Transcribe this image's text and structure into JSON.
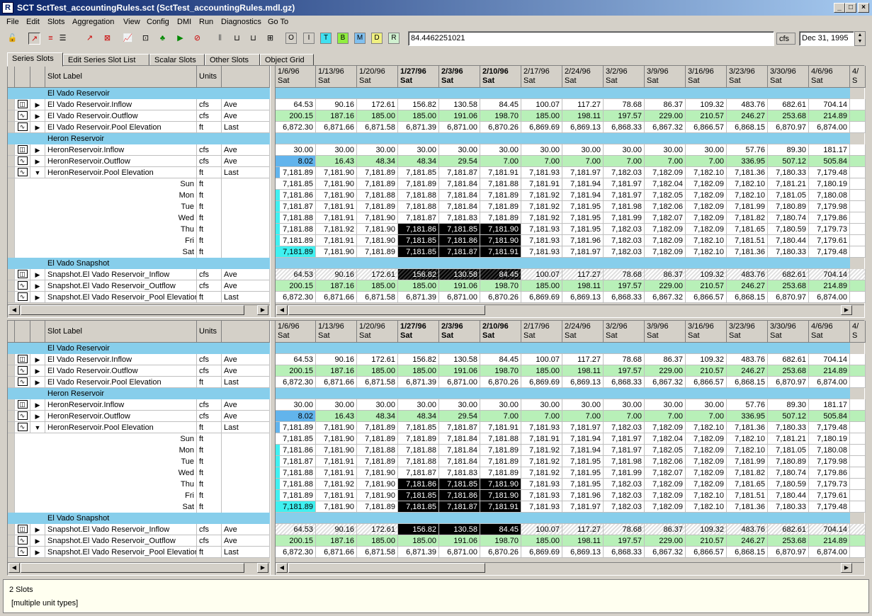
{
  "window": {
    "title": "SCT SctTest_accountingRules.sct (SctTest_accountingRules.mdl.gz)"
  },
  "menu": [
    "File",
    "Edit",
    "Slots",
    "Aggregation",
    "View",
    "Config",
    "DMI",
    "Run",
    "Diagnostics",
    "Go To"
  ],
  "toolbar": {
    "letters": [
      "O",
      "I",
      "T",
      "B",
      "M",
      "D",
      "R"
    ],
    "value": "84.4462251021",
    "units": "cfs",
    "date": "Dec 31, 1995"
  },
  "tabs": [
    "Series Slots",
    "Edit Series Slot List",
    "Scalar Slots",
    "Other Slots",
    "Object Grid"
  ],
  "headers": {
    "slot_label": "Slot Label",
    "units": "Units"
  },
  "dates": [
    {
      "d": "1/6/96",
      "w": "Sat",
      "b": false
    },
    {
      "d": "1/13/96",
      "w": "Sat",
      "b": false
    },
    {
      "d": "1/20/96",
      "w": "Sat",
      "b": false
    },
    {
      "d": "1/27/96",
      "w": "Sat",
      "b": true
    },
    {
      "d": "2/3/96",
      "w": "Sat",
      "b": true
    },
    {
      "d": "2/10/96",
      "w": "Sat",
      "b": true
    },
    {
      "d": "2/17/96",
      "w": "Sat",
      "b": false
    },
    {
      "d": "2/24/96",
      "w": "Sat",
      "b": false
    },
    {
      "d": "3/2/96",
      "w": "Sat",
      "b": false
    },
    {
      "d": "3/9/96",
      "w": "Sat",
      "b": false
    },
    {
      "d": "3/16/96",
      "w": "Sat",
      "b": false
    },
    {
      "d": "3/23/96",
      "w": "Sat",
      "b": false
    },
    {
      "d": "3/30/96",
      "w": "Sat",
      "b": false
    },
    {
      "d": "4/6/96",
      "w": "Sat",
      "b": false
    },
    {
      "d": "4/",
      "w": "S",
      "b": false
    }
  ],
  "rows": [
    {
      "t": "group",
      "label": "El Vado Reservoir"
    },
    {
      "t": "slot",
      "icon": "multi",
      "arrow": "▶",
      "label": "El Vado Reservoir.Inflow",
      "units": "cfs",
      "agg": "Ave",
      "style": "",
      "vals": [
        "64.53",
        "90.16",
        "172.61",
        "156.82",
        "130.58",
        "84.45",
        "100.07",
        "117.27",
        "78.68",
        "86.37",
        "109.32",
        "483.76",
        "682.61",
        "704.14",
        ""
      ]
    },
    {
      "t": "slot",
      "icon": "single",
      "arrow": "▶",
      "label": "El Vado Reservoir.Outflow",
      "units": "cfs",
      "agg": "Ave",
      "style": "green",
      "vals": [
        "200.15",
        "187.16",
        "185.00",
        "185.00",
        "191.06",
        "198.70",
        "185.00",
        "198.11",
        "197.57",
        "229.00",
        "210.57",
        "246.27",
        "253.68",
        "214.89",
        ""
      ]
    },
    {
      "t": "slot",
      "icon": "single",
      "arrow": "▶",
      "label": "El Vado Reservoir.Pool Elevation",
      "units": "ft",
      "agg": "Last",
      "style": "",
      "vals": [
        "6,872.30",
        "6,871.66",
        "6,871.58",
        "6,871.39",
        "6,871.00",
        "6,870.26",
        "6,869.69",
        "6,869.13",
        "6,868.33",
        "6,867.32",
        "6,866.57",
        "6,868.15",
        "6,870.97",
        "6,874.00",
        ""
      ]
    },
    {
      "t": "group",
      "label": "Heron Reservoir"
    },
    {
      "t": "slot",
      "icon": "multi",
      "arrow": "▶",
      "label": "HeronReservoir.Inflow",
      "units": "cfs",
      "agg": "Ave",
      "style": "",
      "vals": [
        "30.00",
        "30.00",
        "30.00",
        "30.00",
        "30.00",
        "30.00",
        "30.00",
        "30.00",
        "30.00",
        "30.00",
        "30.00",
        "57.76",
        "89.30",
        "181.17",
        ""
      ]
    },
    {
      "t": "slot",
      "icon": "single",
      "arrow": "▶",
      "label": "HeronReservoir.Outflow",
      "units": "cfs",
      "agg": "Ave",
      "style": "green",
      "vals": [
        "8.02",
        "16.43",
        "48.34",
        "48.34",
        "29.54",
        "7.00",
        "7.00",
        "7.00",
        "7.00",
        "7.00",
        "7.00",
        "336.95",
        "507.12",
        "505.84",
        ""
      ]
    },
    {
      "t": "slot",
      "icon": "single",
      "arrow": "▼",
      "label": "HeronReservoir.Pool Elevation",
      "units": "ft",
      "agg": "Last",
      "style": "",
      "vals": [
        "7,181.89",
        "7,181.90",
        "7,181.89",
        "7,181.85",
        "7,181.87",
        "7,181.91",
        "7,181.93",
        "7,181.97",
        "7,182.03",
        "7,182.09",
        "7,182.10",
        "7,181.36",
        "7,180.33",
        "7,179.48",
        ""
      ]
    },
    {
      "t": "day",
      "label": "Sun",
      "units": "ft",
      "vals": [
        "7,181.85",
        "7,181.90",
        "7,181.89",
        "7,181.89",
        "7,181.84",
        "7,181.88",
        "7,181.91",
        "7,181.94",
        "7,181.97",
        "7,182.04",
        "7,182.09",
        "7,182.10",
        "7,181.21",
        "7,180.19",
        ""
      ]
    },
    {
      "t": "day",
      "label": "Mon",
      "units": "ft",
      "vals": [
        "7,181.86",
        "7,181.90",
        "7,181.88",
        "7,181.88",
        "7,181.84",
        "7,181.89",
        "7,181.92",
        "7,181.94",
        "7,181.97",
        "7,182.05",
        "7,182.09",
        "7,182.10",
        "7,181.05",
        "7,180.08",
        ""
      ]
    },
    {
      "t": "day",
      "label": "Tue",
      "units": "ft",
      "vals": [
        "7,181.87",
        "7,181.91",
        "7,181.89",
        "7,181.88",
        "7,181.84",
        "7,181.89",
        "7,181.92",
        "7,181.95",
        "7,181.98",
        "7,182.06",
        "7,182.09",
        "7,181.99",
        "7,180.89",
        "7,179.98",
        ""
      ]
    },
    {
      "t": "day",
      "label": "Wed",
      "units": "ft",
      "vals": [
        "7,181.88",
        "7,181.91",
        "7,181.90",
        "7,181.87",
        "7,181.83",
        "7,181.89",
        "7,181.92",
        "7,181.95",
        "7,181.99",
        "7,182.07",
        "7,182.09",
        "7,181.82",
        "7,180.74",
        "7,179.86",
        ""
      ]
    },
    {
      "t": "day",
      "label": "Thu",
      "units": "ft",
      "vals": [
        "7,181.88",
        "7,181.92",
        "7,181.90",
        "7,181.86",
        "7,181.85",
        "7,181.90",
        "7,181.93",
        "7,181.95",
        "7,182.03",
        "7,182.09",
        "7,182.09",
        "7,181.65",
        "7,180.59",
        "7,179.73",
        ""
      ]
    },
    {
      "t": "day",
      "label": "Fri",
      "units": "ft",
      "vals": [
        "7,181.89",
        "7,181.91",
        "7,181.90",
        "7,181.85",
        "7,181.86",
        "7,181.90",
        "7,181.93",
        "7,181.96",
        "7,182.03",
        "7,182.09",
        "7,182.10",
        "7,181.51",
        "7,180.44",
        "7,179.61",
        ""
      ]
    },
    {
      "t": "day",
      "label": "Sat",
      "units": "ft",
      "vals": [
        "7,181.89",
        "7,181.90",
        "7,181.89",
        "7,181.85",
        "7,181.87",
        "7,181.91",
        "7,181.93",
        "7,181.97",
        "7,182.03",
        "7,182.09",
        "7,182.10",
        "7,181.36",
        "7,180.33",
        "7,179.48",
        ""
      ]
    },
    {
      "t": "group",
      "label": "El Vado Snapshot"
    },
    {
      "t": "slot",
      "icon": "multi",
      "arrow": "▶",
      "label": "Snapshot.El Vado Reservoir_Inflow",
      "units": "cfs",
      "agg": "Ave",
      "style": "hatch",
      "vals": [
        "64.53",
        "90.16",
        "172.61",
        "156.82",
        "130.58",
        "84.45",
        "100.07",
        "117.27",
        "78.68",
        "86.37",
        "109.32",
        "483.76",
        "682.61",
        "704.14",
        ""
      ]
    },
    {
      "t": "slot",
      "icon": "single",
      "arrow": "▶",
      "label": "Snapshot.El Vado Reservoir_Outflow",
      "units": "cfs",
      "agg": "Ave",
      "style": "green",
      "vals": [
        "200.15",
        "187.16",
        "185.00",
        "185.00",
        "191.06",
        "198.70",
        "185.00",
        "198.11",
        "197.57",
        "229.00",
        "210.57",
        "246.27",
        "253.68",
        "214.89",
        ""
      ]
    },
    {
      "t": "slot",
      "icon": "single",
      "arrow": "▶",
      "label": "Snapshot.El Vado Reservoir_Pool Elevation",
      "units": "ft",
      "agg": "Last",
      "style": "",
      "vals": [
        "6,872.30",
        "6,871.66",
        "6,871.58",
        "6,871.39",
        "6,871.00",
        "6,870.26",
        "6,869.69",
        "6,869.13",
        "6,868.33",
        "6,867.32",
        "6,866.57",
        "6,868.15",
        "6,870.97",
        "6,874.00",
        ""
      ]
    }
  ],
  "status": {
    "line1": "2 Slots",
    "line2": "[multiple unit types]"
  }
}
